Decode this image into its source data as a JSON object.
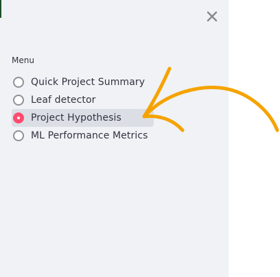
{
  "sidebar": {
    "menu_label": "Menu",
    "close_icon": "close-icon",
    "items": [
      {
        "label": "Quick Project Summary",
        "selected": false
      },
      {
        "label": "Leaf detector",
        "selected": false
      },
      {
        "label": "Project Hypothesis",
        "selected": true
      },
      {
        "label": "ML Performance Metrics",
        "selected": false
      }
    ]
  },
  "colors": {
    "sidebar_bg": "#f0f2f6",
    "selected_bg": "#dcdee6",
    "radio_selected": "#ff4b6e",
    "annotation_arrow": "#f5a300"
  }
}
